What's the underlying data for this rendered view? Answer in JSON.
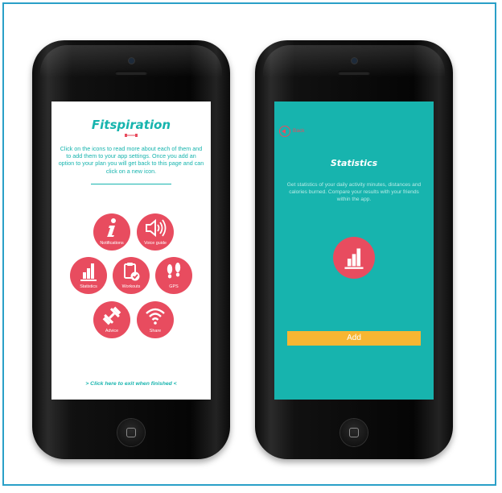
{
  "left_screen": {
    "app_title": "Fitspiration",
    "intro_text": "Click on the icons to read more about each of them and to add them to your app settings. Once you add an option to your plan you will get back to this page and can click on a new icon.",
    "icons": [
      {
        "label": "Notifications",
        "icon": "info-icon"
      },
      {
        "label": "Voice guide",
        "icon": "speaker-icon"
      },
      {
        "label": "Statistics",
        "icon": "bar-chart-icon"
      },
      {
        "label": "Workouts",
        "icon": "clipboard-check-icon"
      },
      {
        "label": "GPS",
        "icon": "footprints-icon"
      },
      {
        "label": "Advice",
        "icon": "dumbbell-icon"
      },
      {
        "label": "Share",
        "icon": "wifi-icon"
      }
    ],
    "exit_link": "> Click here to exit when finished <"
  },
  "right_screen": {
    "back_label": "Back",
    "title": "Statistics",
    "description": "Get statistics of your daily activity minutes, distances and calories burned. Compare your results with your friends within the app.",
    "icon": "bar-chart-icon",
    "add_button": "Add"
  },
  "colors": {
    "accent_teal": "#17b4ae",
    "icon_red": "#e84c5f",
    "button_yellow": "#f7b632",
    "frame_blue": "#2aa0c8"
  }
}
